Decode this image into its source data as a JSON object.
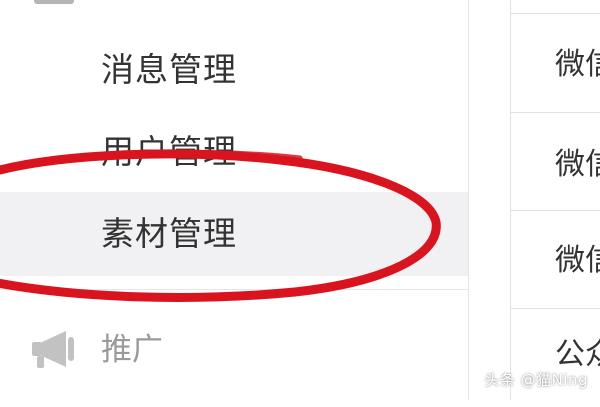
{
  "sidebar": {
    "items": [
      {
        "label": "消息管理",
        "active": false
      },
      {
        "label": "用户管理",
        "active": false
      },
      {
        "label": "素材管理",
        "active": true
      }
    ],
    "promo": {
      "icon": "megaphone-icon",
      "label": "推广"
    }
  },
  "content_list": {
    "rows": [
      {
        "text": "微信"
      },
      {
        "text": "微信"
      },
      {
        "text": "微信"
      },
      {
        "text": "公众"
      }
    ]
  },
  "watermark": {
    "text": "头条 @猫Ning"
  },
  "colors": {
    "active_background": "#f1f1f3",
    "highlight_circle": "#d9141f",
    "text_primary": "#333333",
    "text_muted": "#9a9a9a"
  }
}
